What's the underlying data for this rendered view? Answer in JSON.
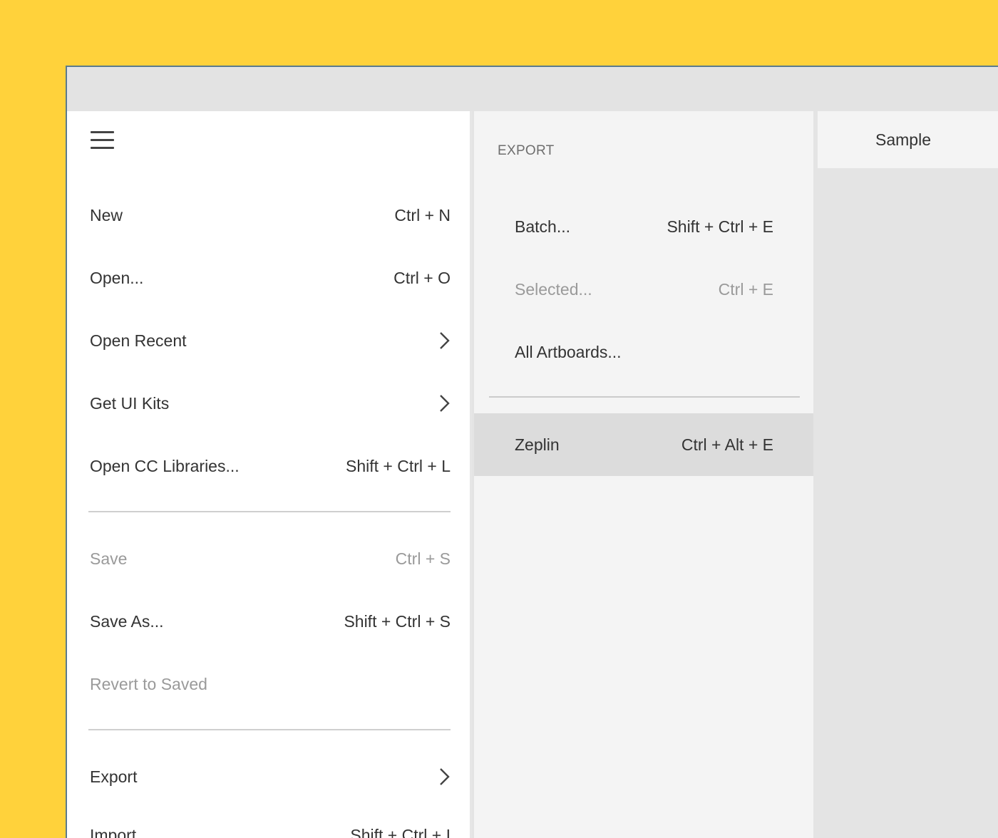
{
  "menu": {
    "items": [
      {
        "label": "New",
        "shortcut": "Ctrl + N"
      },
      {
        "label": "Open...",
        "shortcut": "Ctrl + O"
      },
      {
        "label": "Open Recent",
        "icon": "chevron-right-icon"
      },
      {
        "label": "Get UI Kits",
        "icon": "chevron-right-icon"
      },
      {
        "label": "Open CC Libraries...",
        "shortcut": "Shift + Ctrl + L"
      },
      {
        "label": "Save",
        "shortcut": "Ctrl + S",
        "disabled": true
      },
      {
        "label": "Save As...",
        "shortcut": "Shift + Ctrl + S"
      },
      {
        "label": "Revert to Saved",
        "disabled": true
      },
      {
        "label": "Export",
        "icon": "chevron-right-icon"
      },
      {
        "label": "Import",
        "shortcut": "Shift + Ctrl + I"
      }
    ]
  },
  "export_submenu": {
    "header": "EXPORT",
    "items": [
      {
        "label": "Batch...",
        "shortcut": "Shift + Ctrl + E"
      },
      {
        "label": "Selected...",
        "shortcut": "Ctrl + E",
        "disabled": true
      },
      {
        "label": "All Artboards..."
      },
      {
        "label": "Zeplin",
        "shortcut": "Ctrl + Alt + E",
        "highlighted": true
      }
    ]
  },
  "tab": {
    "label": "Sample"
  },
  "colors": {
    "background": "#FFD23B",
    "menu_bg": "#FFFFFF",
    "submenu_bg": "#F4F4F4",
    "highlight": "#DCDCDC",
    "text": "#333333",
    "disabled_text": "#9A9A9A"
  }
}
